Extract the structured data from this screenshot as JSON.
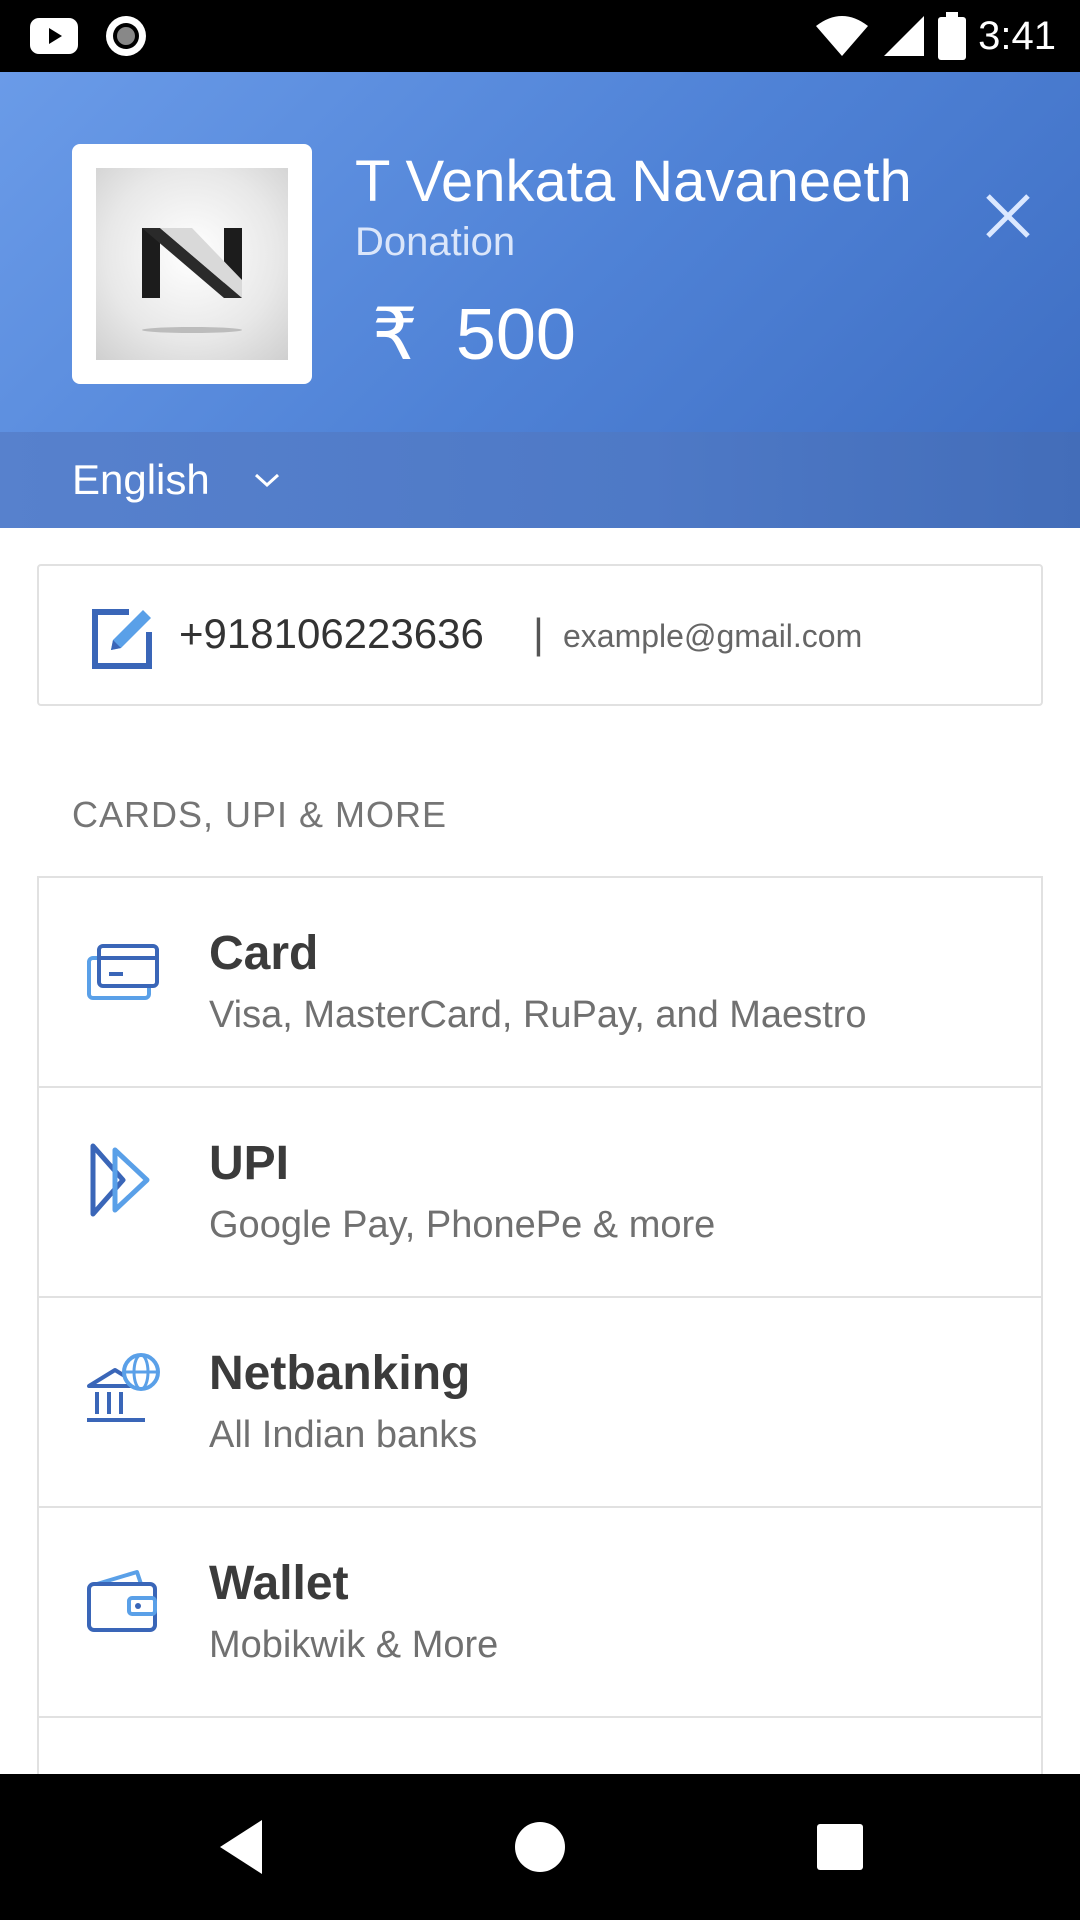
{
  "status_bar": {
    "time": "3:41",
    "left_icons": [
      "youtube-icon",
      "record-icon"
    ],
    "right_icons": [
      "wifi-icon",
      "signal-icon",
      "battery-icon"
    ]
  },
  "header": {
    "merchant_name": "T Venkata Navaneeth",
    "description": "Donation",
    "currency_symbol": "₹",
    "amount": "500",
    "close_icon": "close-icon",
    "logo_icon": "merchant-logo-n"
  },
  "language": {
    "selected": "English",
    "icon": "chevron-down-icon"
  },
  "contact": {
    "phone": "+918106223636",
    "separator": "|",
    "email": "example@gmail.com",
    "icon": "edit-icon"
  },
  "section_title": "CARDS, UPI & MORE",
  "methods": [
    {
      "title": "Card",
      "subtitle": "Visa, MasterCard, RuPay, and Maestro",
      "icon": "card-icon"
    },
    {
      "title": "UPI",
      "subtitle": "Google Pay, PhonePe & more",
      "icon": "upi-icon"
    },
    {
      "title": "Netbanking",
      "subtitle": "All Indian banks",
      "icon": "bank-icon"
    },
    {
      "title": "Wallet",
      "subtitle": "Mobikwik & More",
      "icon": "wallet-icon"
    }
  ],
  "nav_bar": {
    "icons": [
      "back-icon",
      "home-icon",
      "recents-icon"
    ]
  },
  "colors": {
    "header_blue": "#5b8ede",
    "lang_bar_blue": "#4e79c6",
    "icon_blue": "#3a66b8",
    "icon_light_blue": "#5aa0e8",
    "text_dark": "#3b3b3b",
    "text_grey": "#707070"
  }
}
